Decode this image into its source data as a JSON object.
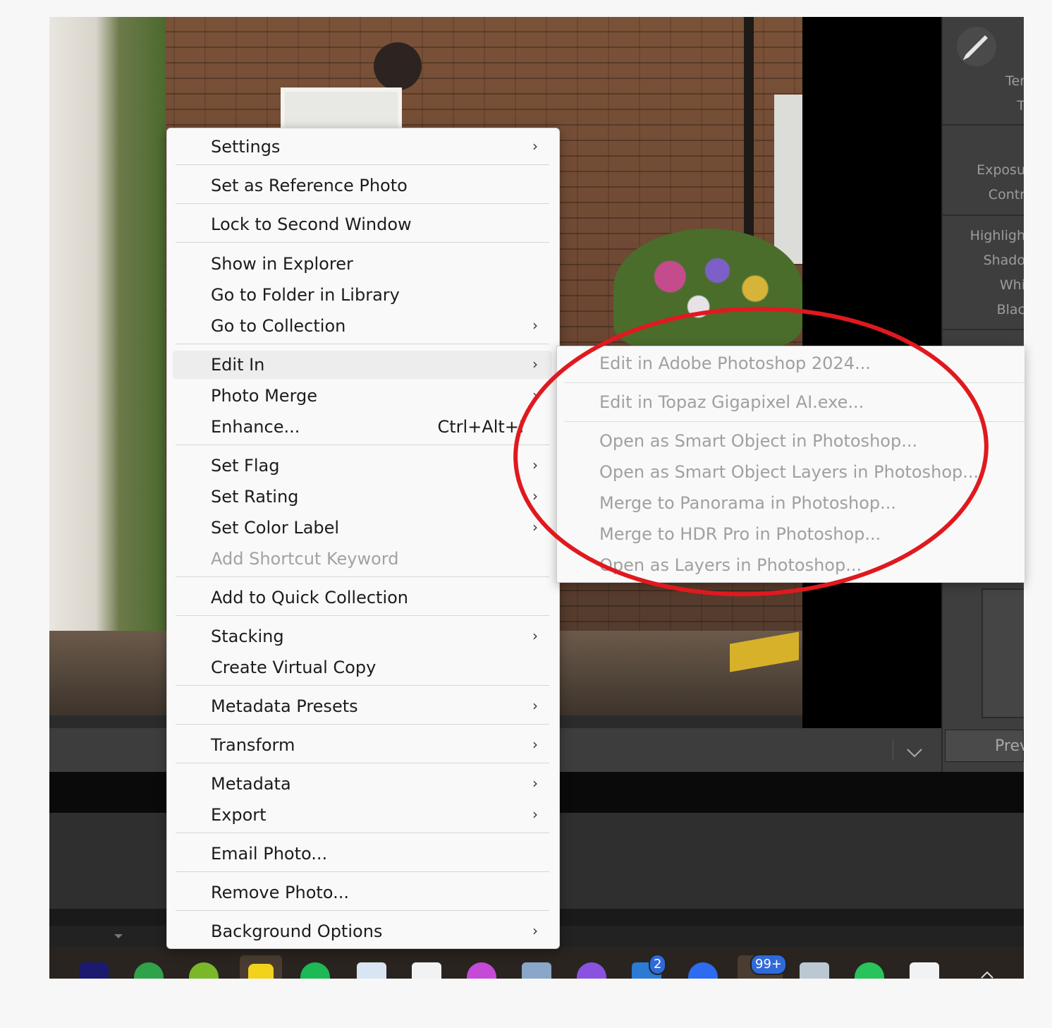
{
  "right_panel": {
    "labels": [
      "Ter",
      "T",
      "Exposu",
      "Contr",
      "Highligh",
      "Shado",
      "Whi",
      "Blac"
    ],
    "preview_button": "Prev"
  },
  "context_menu": {
    "items": [
      {
        "label": "Settings",
        "submenu": true
      },
      {
        "label": "Set as Reference Photo"
      },
      {
        "label": "Lock to Second Window"
      },
      {
        "label": "Show in Explorer"
      },
      {
        "label": "Go to Folder in Library"
      },
      {
        "label": "Go to Collection",
        "submenu": true
      },
      {
        "label": "Edit In",
        "submenu": true,
        "highlighted": true
      },
      {
        "label": "Photo Merge",
        "submenu": true
      },
      {
        "label": "Enhance...",
        "shortcut": "Ctrl+Alt+I"
      },
      {
        "label": "Set Flag",
        "submenu": true
      },
      {
        "label": "Set Rating",
        "submenu": true
      },
      {
        "label": "Set Color Label",
        "submenu": true
      },
      {
        "label": "Add Shortcut Keyword",
        "disabled": true
      },
      {
        "label": "Add to Quick Collection"
      },
      {
        "label": "Stacking",
        "submenu": true
      },
      {
        "label": "Create Virtual Copy"
      },
      {
        "label": "Metadata Presets",
        "submenu": true
      },
      {
        "label": "Transform",
        "submenu": true
      },
      {
        "label": "Metadata",
        "submenu": true
      },
      {
        "label": "Export",
        "submenu": true
      },
      {
        "label": "Email Photo..."
      },
      {
        "label": "Remove Photo..."
      },
      {
        "label": "Background Options",
        "submenu": true
      }
    ],
    "arrow_glyph": "›"
  },
  "edit_in_submenu": {
    "items": [
      "Edit in Adobe Photoshop 2024...",
      "Edit in Topaz Gigapixel AI.exe...",
      "Open as Smart Object in Photoshop...",
      "Open as Smart Object Layers in Photoshop...",
      "Merge to Panorama in Photoshop...",
      "Merge to HDR Pro in Photoshop...",
      "Open as Layers in Photoshop..."
    ]
  },
  "annotation": {
    "color": "#e0191f"
  },
  "taskbar": {
    "badges": [
      "2",
      "99+"
    ],
    "icons": [
      "photo-app-icon",
      "green-globe-icon",
      "lime-app-icon",
      "norton-icon",
      "spotify-icon",
      "translate-icon",
      "microsoft-store-icon",
      "messenger-icon",
      "files-icon",
      "chat-icon",
      "vscode-icon",
      "zoom-icon",
      "outlook-icon",
      "calculator-icon",
      "whatsapp-icon",
      "paint-icon",
      "tray-chevron-icon"
    ]
  }
}
